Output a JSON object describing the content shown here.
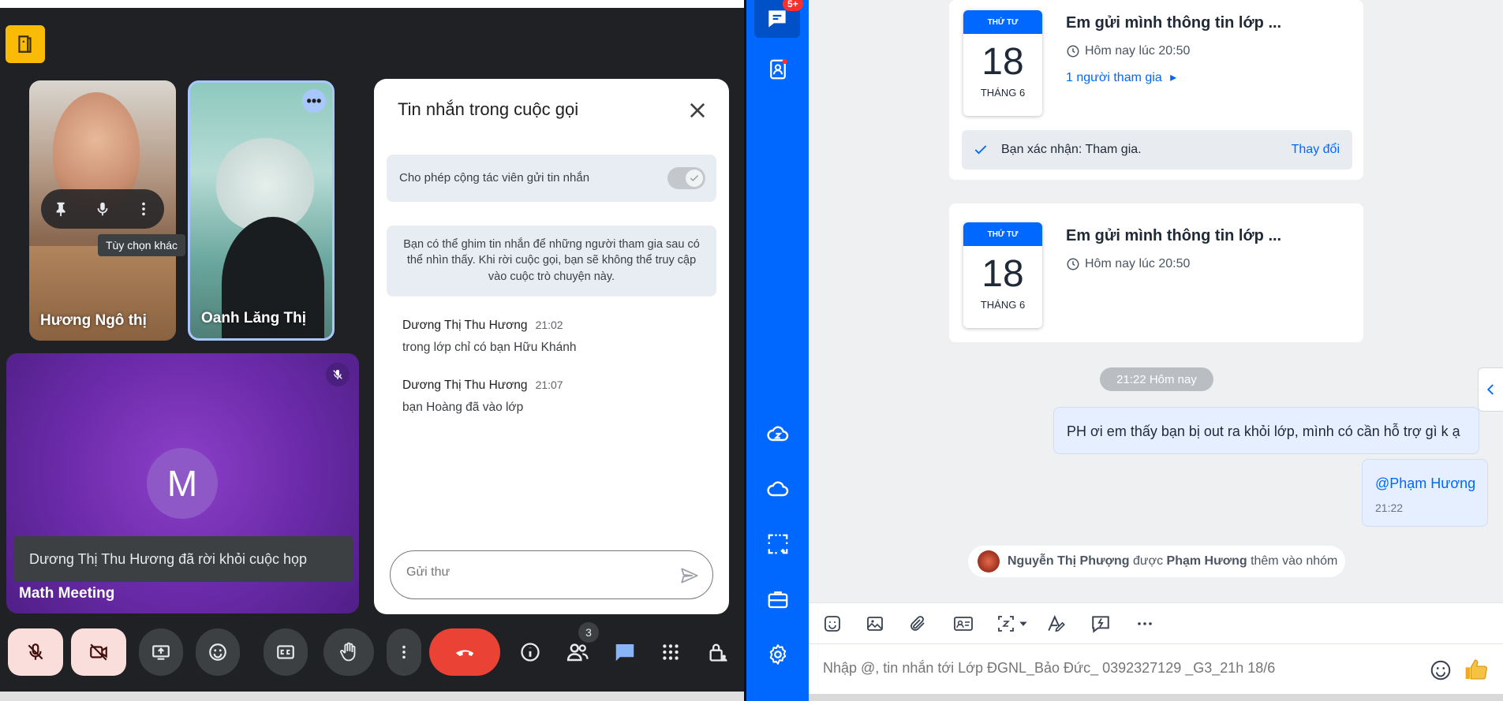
{
  "meet": {
    "tiles": [
      {
        "name": "Hương Ngô thị"
      },
      {
        "name": "Oanh Lăng Thị"
      }
    ],
    "tooltip": "Tùy chọn khác",
    "main_tile": {
      "avatar_letter": "M",
      "name": "Math Meeting"
    },
    "toast": "Dương Thị Thu Hương đã rời khỏi cuộc họp",
    "chat": {
      "title": "Tin nhắn trong cuộc gọi",
      "allow_label": "Cho phép cộng tác viên gửi tin nhắn",
      "allow_enabled": true,
      "info": "Bạn có thể ghim tin nhắn để những người tham gia sau có thể nhìn thấy. Khi rời cuộc gọi, bạn sẽ không thể truy cập vào cuộc trò chuyện này.",
      "messages": [
        {
          "sender": "Dương Thị Thu Hương",
          "time": "21:02",
          "text": "trong lớp chỉ có bạn Hữu Khánh"
        },
        {
          "sender": "Dương Thị Thu Hương",
          "time": "21:07",
          "text": "bạn Hoàng đã vào lớp"
        }
      ],
      "input_placeholder": "Gửi thư"
    },
    "people_count": "3",
    "colors": {
      "accent_yellow": "#f9bb05",
      "hangup_red": "#ea4335",
      "mute_bg": "#f9dedc",
      "chat_blue": "#8ab4f8"
    }
  },
  "zalo": {
    "rail": {
      "message_badge": "5+"
    },
    "events": [
      {
        "weekday": "THỨ TƯ",
        "day": "18",
        "month": "THÁNG 6",
        "title": "Em gửi mình thông tin lớp ...",
        "time": "Hôm nay lúc 20:50",
        "participants": "1 người tham gia",
        "confirm_text": "Bạn xác nhận: Tham gia.",
        "confirm_action": "Thay đổi"
      },
      {
        "weekday": "THỨ TƯ",
        "day": "18",
        "month": "THÁNG 6",
        "title": "Em gửi mình thông tin lớp ...",
        "time": "Hôm nay lúc 20:50"
      }
    ],
    "date_chip": "21:22 Hôm nay",
    "bubbles": [
      {
        "text": "PH ơi em thấy bạn bị out ra khỏi lớp, mình có cần hỗ trợ gì k ạ"
      },
      {
        "mention": "@Phạm Hương",
        "time": "21:22"
      }
    ],
    "notice": {
      "actor": "Nguyễn Thị Phượng",
      "middle": "được",
      "target": "Phạm Hương",
      "end": "thêm vào nhóm"
    },
    "compose_placeholder": "Nhập @, tin nhắn tới Lớp ĐGNL_Bảo Đức_ 0392327129 _G3_21h 18/6",
    "colors": {
      "brand_blue": "#0068ff",
      "bubble_bg": "#e5efff",
      "badge_red": "#ff2e2e"
    }
  }
}
